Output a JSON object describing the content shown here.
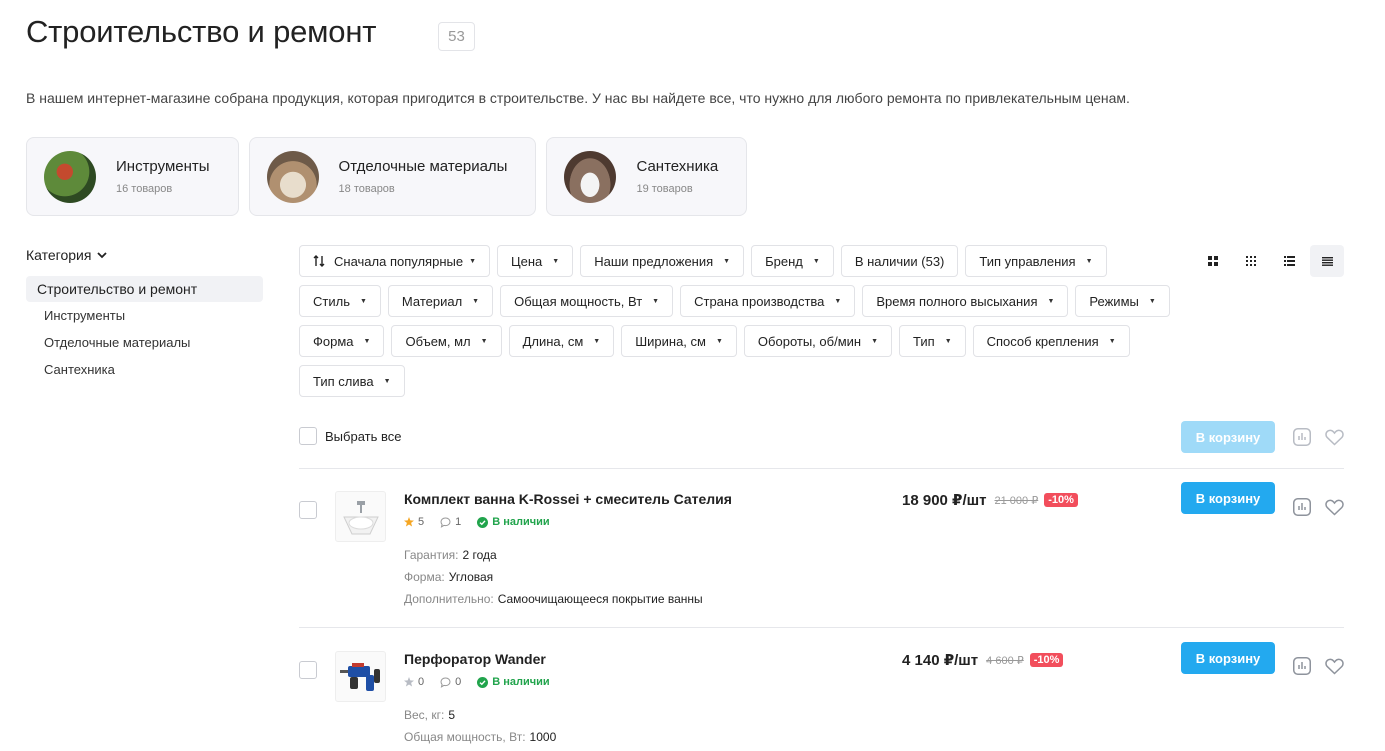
{
  "header": {
    "title": "Строительство и ремонт",
    "count": "53"
  },
  "intro": "В нашем интернет-магазине собрана продукция, которая пригодится в строительстве. У нас вы найдете все, что нужно для любого ремонта по привлекательным ценам.",
  "categories": [
    {
      "name": "Инструменты",
      "count": "16 товаров"
    },
    {
      "name": "Отделочные материалы",
      "count": "18 товаров"
    },
    {
      "name": "Сантехника",
      "count": "19 товаров"
    }
  ],
  "sidebar": {
    "heading": "Категория",
    "active": "Строительство и ремонт",
    "items": [
      "Инструменты",
      "Отделочные материалы",
      "Сантехника"
    ]
  },
  "filters": {
    "sort": "Сначала популярные",
    "chips": [
      "Цена",
      "Наши предложения",
      "Бренд",
      "В наличии (53)",
      "Тип управления",
      "Стиль",
      "Материал",
      "Общая мощность, Вт",
      "Страна производства",
      "Время полного высыхания",
      "Режимы",
      "Форма",
      "Объем, мл",
      "Длина, см",
      "Ширина, см",
      "Обороты, об/мин",
      "Тип",
      "Способ крепления",
      "Тип слива"
    ]
  },
  "toolbar": {
    "select_all": "Выбрать все",
    "cart_label": "В корзину"
  },
  "products": [
    {
      "name": "Комплект ванна K-Rossei + смеситель Сателия",
      "rating": "5",
      "reviews": "1",
      "stock": "В наличии",
      "price": "18 900 ₽/шт",
      "old_price": "21 000 ₽",
      "discount": "-10%",
      "props": [
        {
          "k": "Гарантия:",
          "v": "2 года"
        },
        {
          "k": "Форма:",
          "v": "Угловая"
        },
        {
          "k": "Дополнительно:",
          "v": "Самоочищающееся покрытие ванны"
        }
      ],
      "cart_label": "В корзину",
      "star_color": "#f5a623"
    },
    {
      "name": "Перфоратор Wander",
      "rating": "0",
      "reviews": "0",
      "stock": "В наличии",
      "price": "4 140 ₽/шт",
      "old_price": "4 600 ₽",
      "discount": "-10%",
      "props": [
        {
          "k": "Вес, кг:",
          "v": "5"
        },
        {
          "k": "Общая мощность, Вт:",
          "v": "1000"
        }
      ],
      "cart_label": "В корзину",
      "star_color": "#b8bcc4"
    }
  ],
  "colors": {
    "accent": "#23a9ef",
    "accent_disabled": "#9fdaf8",
    "discount": "#f24e5c",
    "stock": "#21a44c"
  }
}
